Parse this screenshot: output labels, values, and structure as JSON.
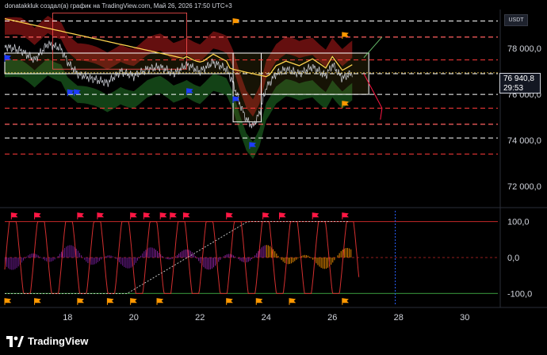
{
  "header": {
    "caption": "donatakkluk создал(а) график на TradingView.com, Май 26, 2026 17:50 UTC+3",
    "symbol_badge": "USDT"
  },
  "price_label": {
    "value": "76 940,8",
    "countdown": "29:53"
  },
  "footer": {
    "brand": "TradingView"
  },
  "colors": {
    "background": "#000000",
    "price_line": "#d1d4dc",
    "upper_band": "#b71c1c",
    "lower_band": "#1b5e20",
    "ma_line": "#ffd54f",
    "level_red": "#ff3b3b",
    "level_white": "#ffffff",
    "osc_line": "#d32f2f",
    "buy_flag": "#1e3cff",
    "sell_flag": "#ff9800",
    "red_flag": "#ff1744"
  },
  "chart_data": [
    {
      "type": "line",
      "title": "",
      "x_ticks": [
        "18",
        "20",
        "22",
        "24",
        "26",
        "28",
        "30"
      ],
      "x_range": [
        16.1,
        31.0
      ],
      "y_ticks": [
        "72 000,0",
        "74 000,0",
        "76 000,0",
        "78 000,0"
      ],
      "ylim": [
        71200,
        79700
      ],
      "last_price": 76940.8,
      "series": [
        {
          "x": [
            16.1,
            16.6,
            17.0,
            17.4,
            17.8,
            18.0,
            18.3,
            18.7,
            19.2,
            19.6,
            20.0,
            20.4,
            20.8,
            21.2,
            21.6,
            22.0,
            22.4,
            22.8,
            23.0,
            23.2,
            23.4,
            23.6,
            23.8,
            24.0,
            24.3,
            24.6,
            25.0,
            25.4,
            25.8,
            26.0,
            26.3,
            26.6
          ],
          "y": [
            78100,
            77900,
            77500,
            78200,
            78000,
            77400,
            76900,
            76700,
            76500,
            77000,
            76800,
            77100,
            77200,
            76900,
            77300,
            77000,
            77400,
            77100,
            76500,
            75600,
            74900,
            74600,
            75200,
            76300,
            76900,
            77100,
            76900,
            77200,
            76800,
            77300,
            76700,
            76940
          ]
        }
      ],
      "levels_white": [
        79200,
        78500,
        76900,
        76000,
        74700,
        74100
      ],
      "levels_red": [
        78500,
        77500,
        75400,
        74700,
        73400
      ],
      "boxes": [
        {
          "x0": 16.1,
          "x1": 23.0,
          "y0": 76900,
          "y1": 77800,
          "edge": "white"
        },
        {
          "x0": 23.0,
          "x1": 23.85,
          "y0": 74800,
          "y1": 77800,
          "edge": "white"
        },
        {
          "x0": 23.85,
          "x1": 27.1,
          "y0": 76000,
          "y1": 77800,
          "edge": "white"
        }
      ]
    },
    {
      "type": "line",
      "title": "",
      "y_ticks": [
        "100,0",
        "0,0",
        "-100,0"
      ],
      "ylim": [
        -130,
        130
      ],
      "levels": [
        100,
        0,
        -100
      ]
    }
  ]
}
